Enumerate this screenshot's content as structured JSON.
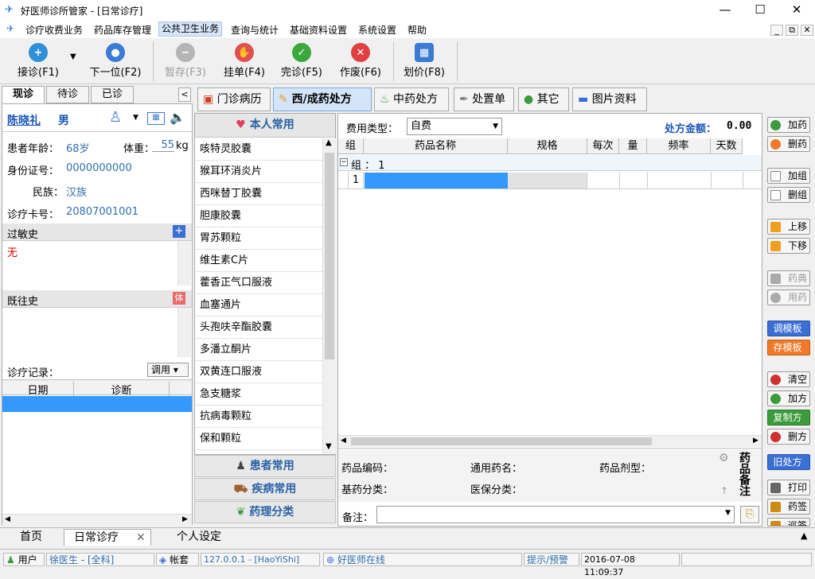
{
  "window": {
    "title": "好医师诊所管家 - [日常诊疗]"
  },
  "menu": [
    "诊疗收费业务",
    "药品库存管理",
    "公共卫生业务",
    "查询与统计",
    "基础资料设置",
    "系统设置",
    "帮助"
  ],
  "toolbar": {
    "receive": "接诊(F1)",
    "next": "下一位(F2)",
    "pause": "暂存(F3)",
    "hang": "挂单(F4)",
    "finish": "完诊(F5)",
    "void": "作废(F6)",
    "price": "划价(F8)"
  },
  "left_tabs": [
    "现诊",
    "待诊",
    "已诊"
  ],
  "patient": {
    "name": "陈晓礼",
    "sex": "男",
    "age_label": "患者年龄：",
    "age": "68岁",
    "weight_label": "体重：",
    "weight": "55",
    "weight_unit": "kg",
    "id_label": "身份证号：",
    "id": "0000000000",
    "nation_label": "民族：",
    "nation": "汉族",
    "card_label": "诊疗卡号：",
    "card": "20807001001"
  },
  "allergy": {
    "title": "过敏史",
    "value": "无"
  },
  "history": {
    "title": "既往史",
    "badge": "体"
  },
  "records": {
    "label": "诊疗记录：",
    "button": "调用",
    "cols": [
      "日期",
      "诊断"
    ]
  },
  "drug_panel": {
    "title": "本人常用",
    "items": [
      "咳特灵胶囊",
      "猴耳环消炎片",
      "西咪替丁胶囊",
      "胆康胶囊",
      "胃苏颗粒",
      "维生素C片",
      "藿香正气口服液",
      "血塞通片",
      "头孢呋辛酯胶囊",
      "多潘立酮片",
      "双黄连口服液",
      "急支糖浆",
      "抗病毒颗粒",
      "保和颗粒"
    ],
    "cat1": "患者常用",
    "cat2": "疾病常用",
    "cat3": "药理分类"
  },
  "main_tabs": [
    "门诊病历",
    "西/成药处方",
    "中药处方",
    "处置单",
    "其它",
    "图片资料"
  ],
  "rx": {
    "fee_label": "费用类型：",
    "fee": "自费",
    "amount_label": "处方金额：",
    "amount": "0.00",
    "cols": [
      "组",
      "药品名称",
      "规格",
      "每次",
      "量",
      "频率",
      "天数"
    ],
    "group": "组 ： 1",
    "row": "1"
  },
  "info": {
    "code": "药品编码：",
    "generic": "通用药名：",
    "form": "药品剂型：",
    "basic": "基药分类：",
    "insurance": "医保分类：",
    "side": "药品备注",
    "remark": "备注："
  },
  "right_buttons": {
    "add_drug": "加药",
    "del_drug": "删药",
    "add_group": "加组",
    "del_group": "删组",
    "up": "上移",
    "down": "下移",
    "dict": "药典",
    "usage": "用药",
    "tpl_load": "调模板",
    "tpl_save": "存模板",
    "clear": "清空",
    "add_rx": "加方",
    "copy_rx": "复制方",
    "del_rx": "删方",
    "old_rx": "旧处方",
    "print": "打印",
    "label": "药签",
    "tour": "巡签"
  },
  "bottom_tabs": [
    "首页",
    "日常诊疗",
    "个人设定"
  ],
  "status": {
    "user_label": "用户",
    "user": "徐医生 - [全科]",
    "account_label": "帐套",
    "server": "127.0.0.1 - [HaoYiShi]",
    "online": "好医师在线",
    "hint": "提示/预警",
    "datetime": "2016-07-08 11:09:37"
  }
}
